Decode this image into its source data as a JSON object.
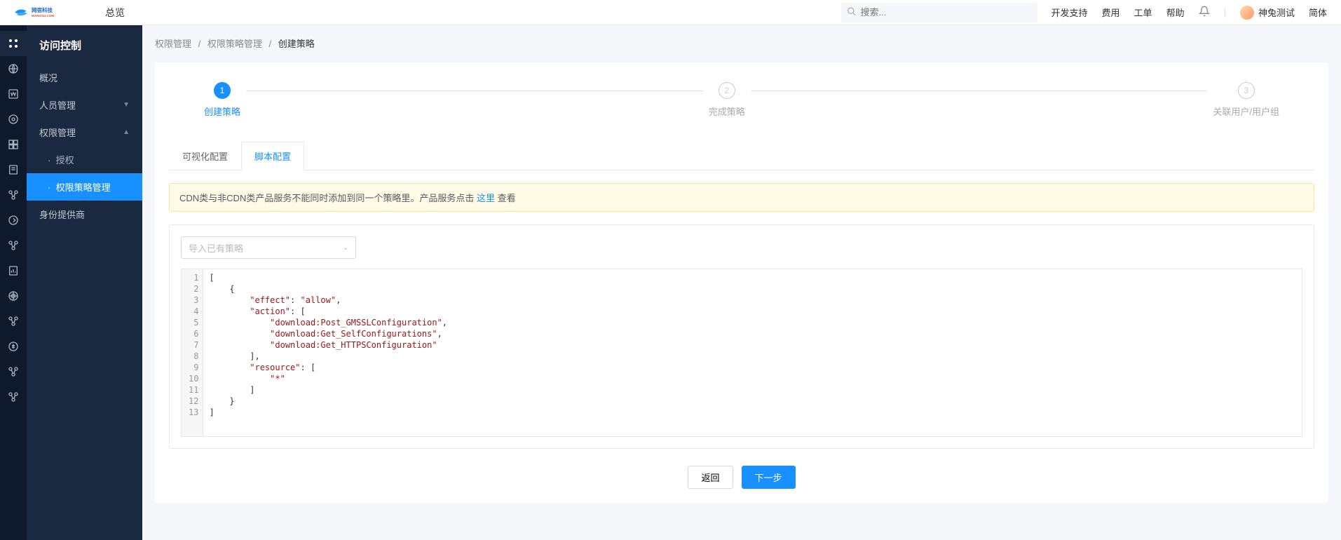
{
  "header": {
    "brand_cn": "网宿科技",
    "brand_en": "WANGSU.COM",
    "overview": "总览",
    "search_placeholder": "搜索...",
    "links": [
      "开发支持",
      "费用",
      "工单",
      "帮助"
    ],
    "username": "神兔测试",
    "lang": "简体"
  },
  "sidebar": {
    "title": "访问控制",
    "items": [
      {
        "label": "概况"
      },
      {
        "label": "人员管理",
        "expandable": true,
        "expanded": false
      },
      {
        "label": "权限管理",
        "expandable": true,
        "expanded": true,
        "children": [
          {
            "label": "授权"
          },
          {
            "label": "权限策略管理",
            "active": true
          }
        ]
      },
      {
        "label": "身份提供商"
      }
    ],
    "bullet": "·"
  },
  "breadcrumb": [
    "权限管理",
    "权限策略管理",
    "创建策略"
  ],
  "steps": [
    {
      "num": "1",
      "label": "创建策略",
      "active": true
    },
    {
      "num": "2",
      "label": "完成策略"
    },
    {
      "num": "3",
      "label": "关联用户/用户组"
    }
  ],
  "tabs": [
    {
      "label": "可视化配置"
    },
    {
      "label": "脚本配置",
      "active": true
    }
  ],
  "alert": {
    "text_before": "CDN类与非CDN类产品服务不能同时添加到同一个策略里。产品服务点击 ",
    "link": "这里",
    "text_after": " 查看"
  },
  "select_placeholder": "导入已有策略",
  "code": {
    "lines": [
      {
        "n": "1",
        "plain": "["
      },
      {
        "n": "2",
        "plain": "    {"
      },
      {
        "n": "3",
        "indent": "        ",
        "key": "\"effect\"",
        "sep": ": ",
        "val": "\"allow\"",
        "tail": ","
      },
      {
        "n": "4",
        "indent": "        ",
        "key": "\"action\"",
        "sep": ": [",
        "tail": ""
      },
      {
        "n": "5",
        "indent": "            ",
        "val": "\"download:Post_GMSSLConfiguration\"",
        "tail": ","
      },
      {
        "n": "6",
        "indent": "            ",
        "val": "\"download:Get_SelfConfigurations\"",
        "tail": ","
      },
      {
        "n": "7",
        "indent": "            ",
        "val": "\"download:Get_HTTPSConfiguration\"",
        "tail": ""
      },
      {
        "n": "8",
        "plain": "        ],"
      },
      {
        "n": "9",
        "indent": "        ",
        "key": "\"resource\"",
        "sep": ": [",
        "tail": ""
      },
      {
        "n": "10",
        "indent": "            ",
        "val": "\"*\"",
        "tail": ""
      },
      {
        "n": "11",
        "plain": "        ]"
      },
      {
        "n": "12",
        "plain": "    }"
      },
      {
        "n": "13",
        "plain": "]"
      }
    ]
  },
  "buttons": {
    "back": "返回",
    "next": "下一步"
  }
}
